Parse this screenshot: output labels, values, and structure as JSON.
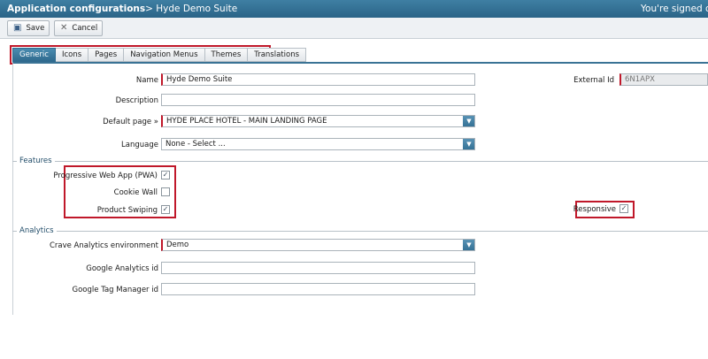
{
  "titlebar": {
    "app": "Application configurations",
    "crumb": "> Hyde Demo Suite",
    "signed": "You're signed on a"
  },
  "toolbar": {
    "save_label": "Save",
    "cancel_label": "Cancel",
    "save_icon": "floppy-disk-icon",
    "cancel_icon": "close-icon"
  },
  "tabs": [
    {
      "label": "Generic",
      "active": true
    },
    {
      "label": "Icons",
      "active": false
    },
    {
      "label": "Pages",
      "active": false
    },
    {
      "label": "Navigation Menus",
      "active": false
    },
    {
      "label": "Themes",
      "active": false
    },
    {
      "label": "Translations",
      "active": false
    }
  ],
  "generic": {
    "name_label": "Name",
    "name_value": "Hyde Demo Suite",
    "external_id_label": "External Id",
    "external_id_value": "6N1APX",
    "description_label": "Description",
    "description_value": "",
    "default_page_label": "Default page »",
    "default_page_value": "HYDE PLACE HOTEL - MAIN LANDING PAGE",
    "language_label": "Language",
    "language_value": "None - Select ..."
  },
  "features": {
    "section_label": "Features",
    "pwa_label": "Progressive Web App (PWA)",
    "pwa_checked": true,
    "cookie_wall_label": "Cookie Wall",
    "cookie_wall_checked": false,
    "product_swiping_label": "Product Swiping",
    "product_swiping_checked": true,
    "responsive_label": "Responsive",
    "responsive_checked": true
  },
  "analytics": {
    "section_label": "Analytics",
    "crave_env_label": "Crave Analytics environment",
    "crave_env_value": "Demo",
    "ga_label": "Google Analytics id",
    "ga_value": "",
    "gtm_label": "Google Tag Manager id",
    "gtm_value": ""
  },
  "colors": {
    "header": "#2b6487",
    "accent": "#3a7395",
    "highlight": "#c0182a"
  }
}
